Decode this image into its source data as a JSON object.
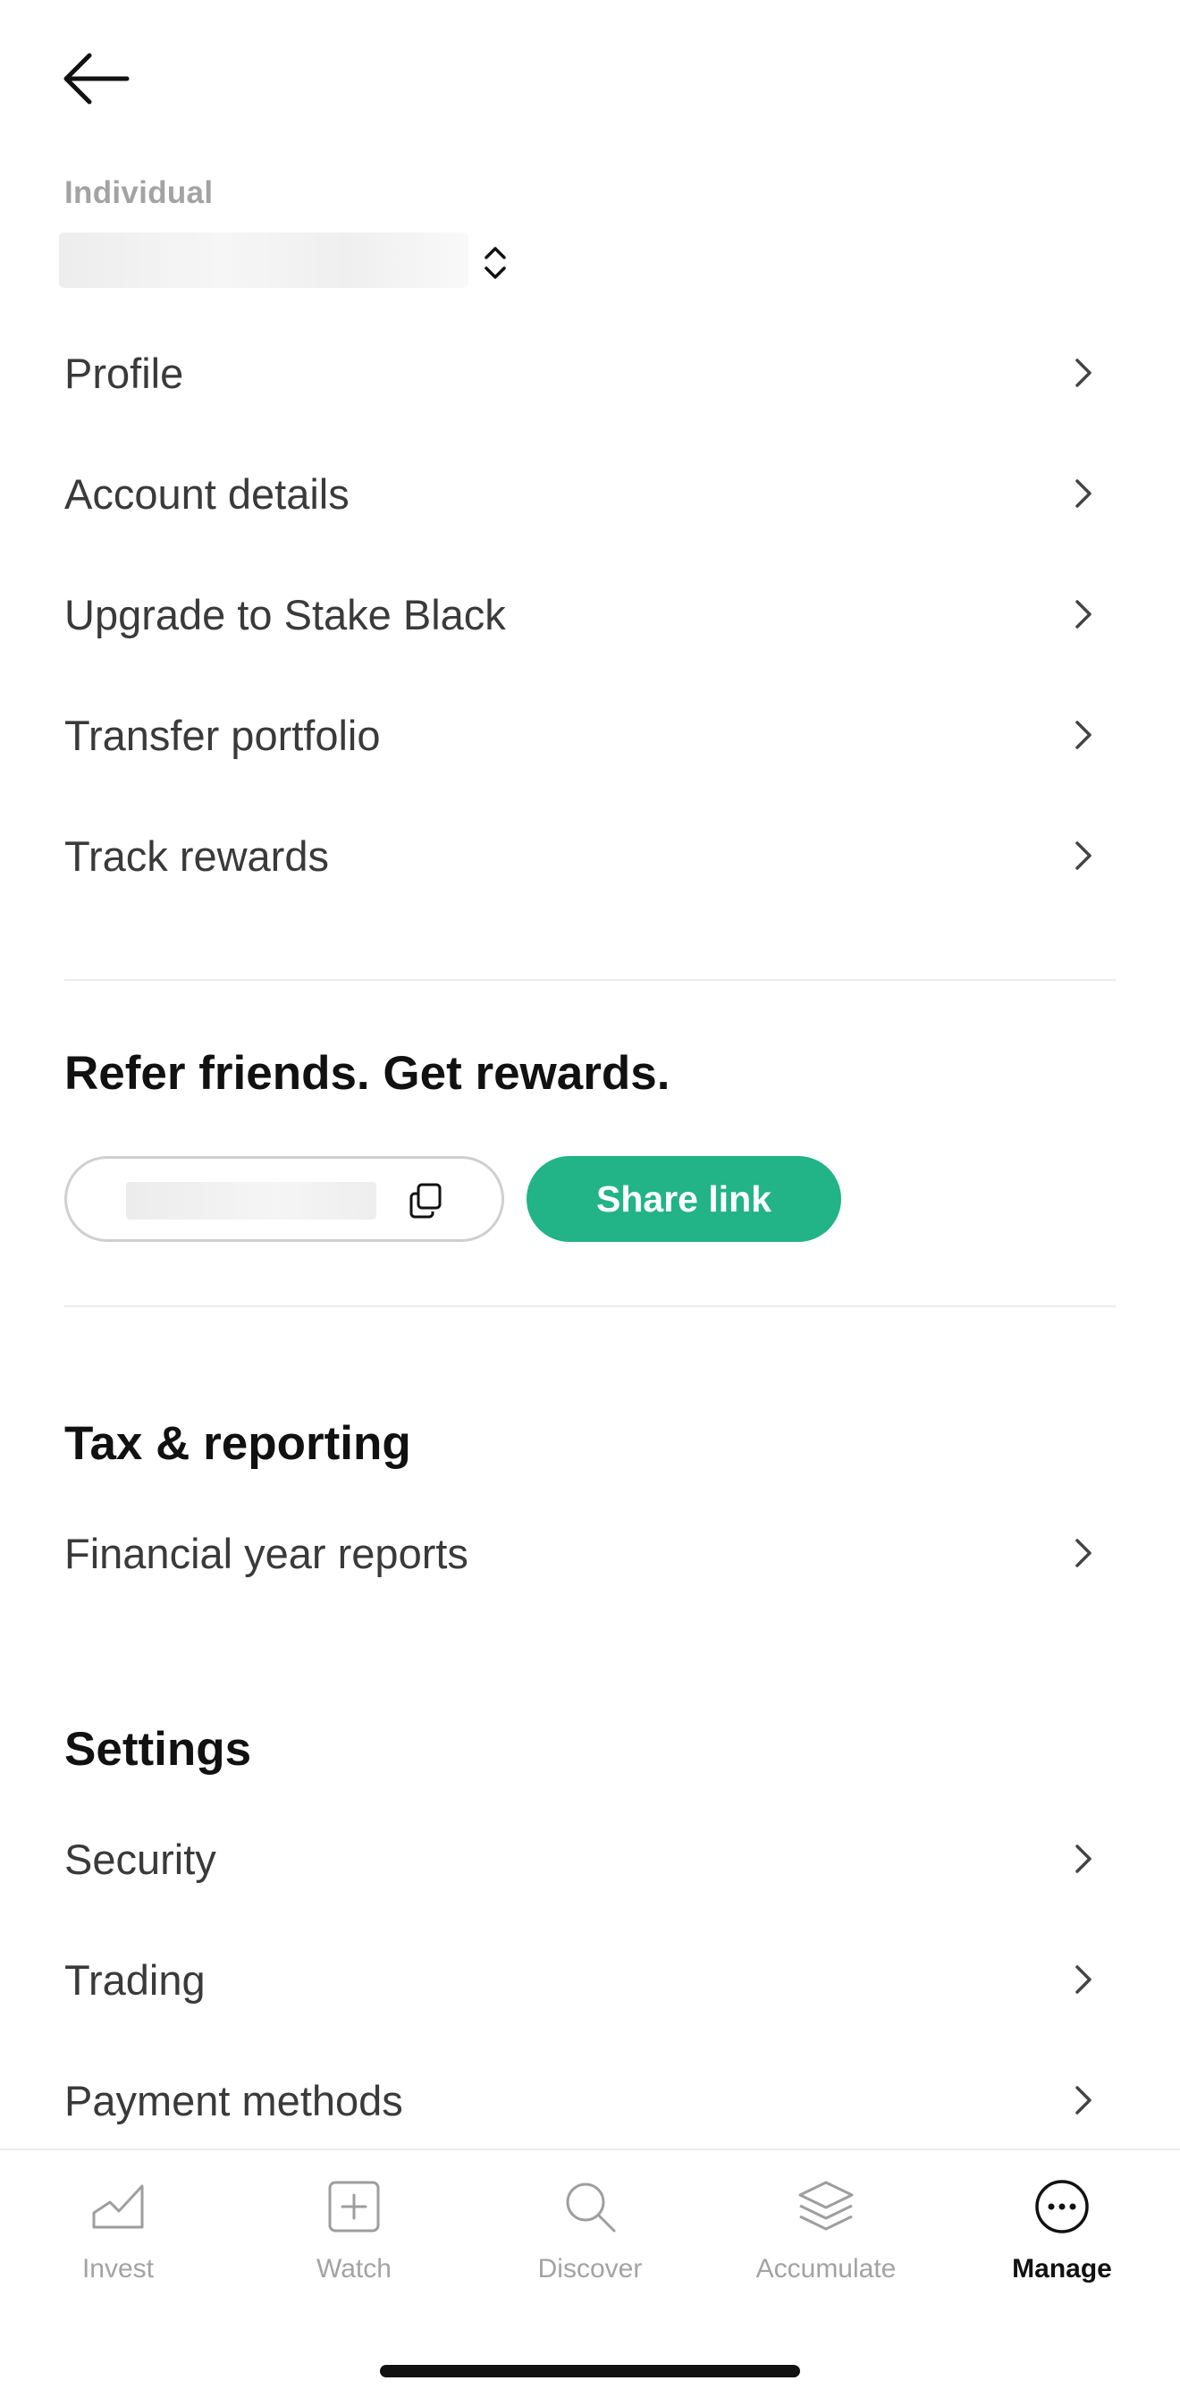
{
  "account": {
    "type_label": "Individual"
  },
  "account_menu": [
    {
      "label": "Profile"
    },
    {
      "label": "Account details"
    },
    {
      "label": "Upgrade to Stake Black"
    },
    {
      "label": "Transfer portfolio"
    },
    {
      "label": "Track rewards"
    }
  ],
  "referral": {
    "title": "Refer friends. Get rewards.",
    "share_label": "Share link"
  },
  "tax": {
    "title": "Tax & reporting",
    "items": [
      {
        "label": "Financial year reports"
      }
    ]
  },
  "settings": {
    "title": "Settings",
    "items": [
      {
        "label": "Security"
      },
      {
        "label": "Trading"
      },
      {
        "label": "Payment methods"
      }
    ]
  },
  "tabbar": {
    "active": "Manage",
    "tabs": [
      {
        "label": "Invest",
        "icon": "chart-icon"
      },
      {
        "label": "Watch",
        "icon": "plus-square-icon"
      },
      {
        "label": "Discover",
        "icon": "search-icon"
      },
      {
        "label": "Accumulate",
        "icon": "layers-icon"
      },
      {
        "label": "Manage",
        "icon": "more-circle-icon"
      }
    ]
  },
  "colors": {
    "accent": "#22b387",
    "text": "#1a1a1a",
    "muted": "#a3a3a3"
  }
}
